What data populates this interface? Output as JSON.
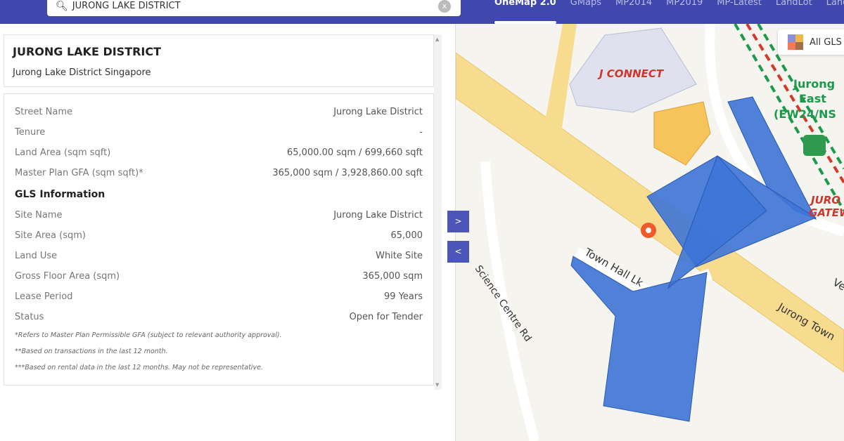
{
  "search": {
    "value": "JURONG LAKE DISTRICT",
    "clear_icon": "x"
  },
  "tabs": [
    {
      "label": "OneMap 2.0",
      "active": true
    },
    {
      "label": "GMaps"
    },
    {
      "label": "MP2014"
    },
    {
      "label": "MP2019"
    },
    {
      "label": "MP-Latest"
    },
    {
      "label": "LandLot"
    },
    {
      "label": "Land"
    }
  ],
  "card": {
    "title": "JURONG LAKE DISTRICT",
    "subtitle": "Jurong Lake District Singapore"
  },
  "details": [
    {
      "label": "Street Name",
      "value": "Jurong Lake District"
    },
    {
      "label": "Tenure",
      "value": "-"
    },
    {
      "label": "Land Area (sqm sqft)",
      "value": "65,000.00 sqm / 699,660 sqft"
    },
    {
      "label": "Master Plan GFA (sqm sqft)*",
      "value": "365,000 sqm / 3,928,860.00 sqft"
    }
  ],
  "gls": {
    "heading": "GLS Information",
    "rows": [
      {
        "label": "Site Name",
        "value": "Jurong Lake District"
      },
      {
        "label": "Site Area (sqm)",
        "value": "65,000"
      },
      {
        "label": "Land Use",
        "value": "White Site"
      },
      {
        "label": "Gross Floor Area (sqm)",
        "value": "365,000 sqm"
      },
      {
        "label": "Lease Period",
        "value": "99 Years"
      },
      {
        "label": "Status",
        "value": "Open for Tender"
      }
    ]
  },
  "notes": [
    "*Refers to Master Plan Permissible GFA (subject to relevant authority approval).",
    "**Based on transactions in the last 12 month.",
    "***Based on rental data in the last 12 months. May not be representative."
  ],
  "toggles": {
    "expand": ">",
    "collapse": "<"
  },
  "layer_button": {
    "label": "All GLS",
    "colors": [
      "#8b8fd9",
      "#f0b84a",
      "#f07a5a",
      "#a0704a"
    ]
  },
  "map_labels": {
    "building": "J CONNECT",
    "station": [
      "Jurong",
      "East",
      "(EW24/NS"
    ],
    "station2": [
      "JURO",
      "GATEW"
    ],
    "road1": "Town Hall Lk",
    "road2": "Science Centre Rd",
    "road3": "Jurong Town",
    "road4": "Ve"
  },
  "colors": {
    "header": "#4047ad",
    "parcel": "#3d74d6",
    "accent": "#4c55b8"
  }
}
